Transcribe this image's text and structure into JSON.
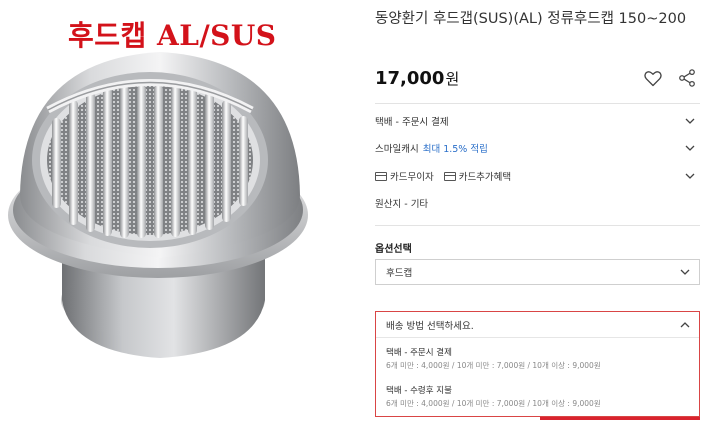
{
  "product_image": {
    "caption": "후드캡 AL/SUS",
    "caption_color": "#d3121a"
  },
  "product": {
    "title": "동양환기 후드갭(SUS)(AL) 정류후드캡 150~200",
    "price_number": "17,000",
    "price_unit": "원"
  },
  "info": {
    "delivery": "택배 - 주문시 결제",
    "cash_label": "스마일캐시",
    "cash_highlight": "최대 1.5% 적립",
    "card_free": "카드무이자",
    "card_extra": "카드추가혜택",
    "origin": "원산지 - 기타"
  },
  "options": {
    "label": "옵션선택",
    "selected": "후드캡"
  },
  "shipping_dropdown": {
    "placeholder": "배송 방법 선택하세요.",
    "items": [
      {
        "title": "택배 - 주문시 결제",
        "detail": "6개 미만 : 4,000원 / 10개 미만 : 7,000원 / 10개 이상 : 9,000원"
      },
      {
        "title": "택배 - 수령후 지불",
        "detail": "6개 미만 : 4,000원 / 10개 미만 : 7,000원 / 10개 이상 : 9,000원"
      }
    ]
  },
  "colors": {
    "accent_red": "#d9232e",
    "link_blue": "#2a6fc9"
  },
  "icons": [
    "heart-icon",
    "share-icon",
    "chevron-down-icon",
    "chevron-up-icon",
    "card-icon"
  ]
}
